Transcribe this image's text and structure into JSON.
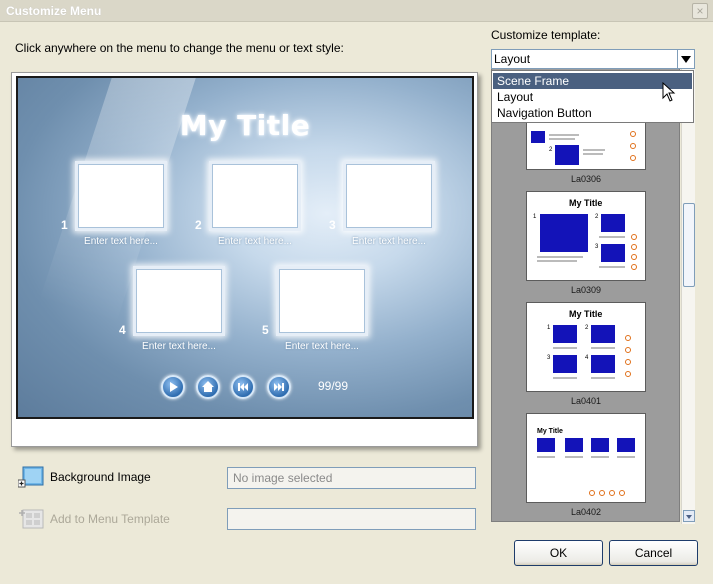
{
  "window": {
    "title": "Customize Menu",
    "close_glyph": "×"
  },
  "instruction": "Click anywhere on the menu to change the menu or text style:",
  "preview": {
    "menu_title": "My Title",
    "items": [
      {
        "number": "1",
        "caption": "Enter text here..."
      },
      {
        "number": "2",
        "caption": "Enter text here..."
      },
      {
        "number": "3",
        "caption": "Enter text here..."
      },
      {
        "number": "4",
        "caption": "Enter text here..."
      },
      {
        "number": "5",
        "caption": "Enter text here..."
      }
    ],
    "nav_icons": [
      "play-icon",
      "home-icon",
      "previous-icon",
      "next-icon"
    ],
    "page_indicator": "99/99"
  },
  "background_image": {
    "label": "Background Image",
    "value": "No image selected"
  },
  "add_to_template": {
    "label": "Add to Menu Template",
    "value": ""
  },
  "customize_template": {
    "label": "Customize template:",
    "selected": "Layout",
    "options": [
      "Scene Frame",
      "Layout",
      "Navigation Button"
    ],
    "highlighted_option": "Scene Frame"
  },
  "templates": [
    {
      "name": "La0306"
    },
    {
      "name": "La0309",
      "title": "My Title"
    },
    {
      "name": "La0401",
      "title": "My Title"
    },
    {
      "name": "La0402",
      "title": "My Title"
    }
  ],
  "buttons": {
    "ok": "OK",
    "cancel": "Cancel"
  },
  "colors": {
    "accent": "#1313b8",
    "selection": "#4a6080",
    "nav_dot": "#e0701a"
  }
}
